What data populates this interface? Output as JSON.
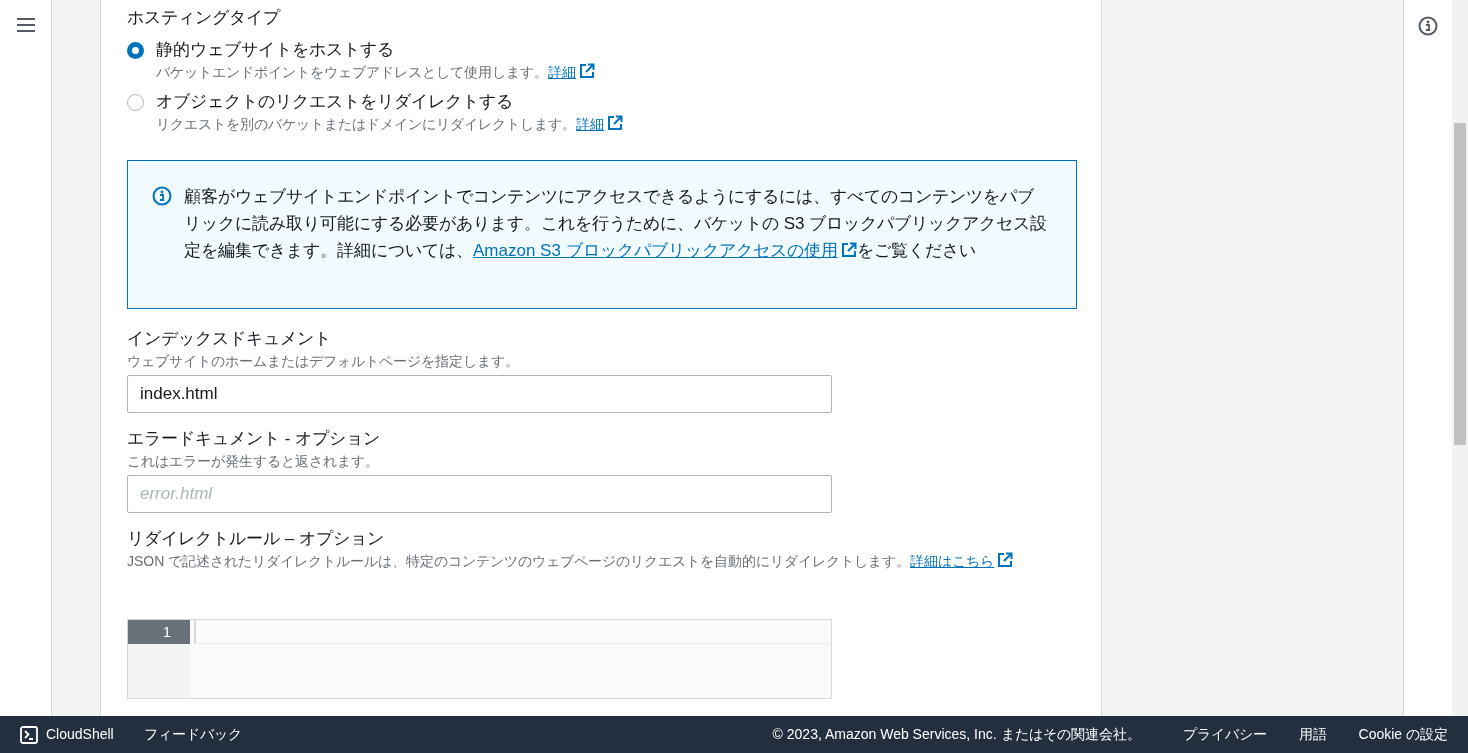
{
  "hosting_type": {
    "label": "ホスティングタイプ",
    "options": [
      {
        "label": "静的ウェブサイトをホストする",
        "description": "バケットエンドポイントをウェブアドレスとして使用します。",
        "link": "詳細",
        "selected": true
      },
      {
        "label": "オブジェクトのリクエストをリダイレクトする",
        "description": "リクエストを別のバケットまたはドメインにリダイレクトします。",
        "link": "詳細",
        "selected": false
      }
    ]
  },
  "info_alert": {
    "text_before": "顧客がウェブサイトエンドポイントでコンテンツにアクセスできるようにするには、すべてのコンテンツをパブリックに読み取り可能にする必要があります。これを行うために、バケットの S3 ブロックパブリックアクセス設定を編集できます。詳細については、",
    "link": "Amazon S3 ブロックパブリックアクセスの使用",
    "text_after": "をご覧ください"
  },
  "fields": [
    {
      "label": "インデックスドキュメント",
      "description": "ウェブサイトのホームまたはデフォルトページを指定します。",
      "value": "index.html"
    },
    {
      "label": "エラードキュメント - オプション",
      "description": "これはエラーが発生すると返されます。",
      "placeholder": "error.html"
    }
  ],
  "redirect_rules": {
    "label": "リダイレクトルール – オプション",
    "description": "JSON で記述されたリダイレクトルールは、特定のコンテンツのウェブページのリクエストを自動的にリダイレクトします。",
    "link": "詳細はこちら",
    "line_numbers": [
      "1"
    ]
  },
  "footer": {
    "left": [
      "CloudShell",
      "フィードバック"
    ],
    "copyright": "© 2023, Amazon Web Services, Inc. またはその関連会社。",
    "right": [
      "プライバシー",
      "用語",
      "Cookie の設定"
    ]
  }
}
